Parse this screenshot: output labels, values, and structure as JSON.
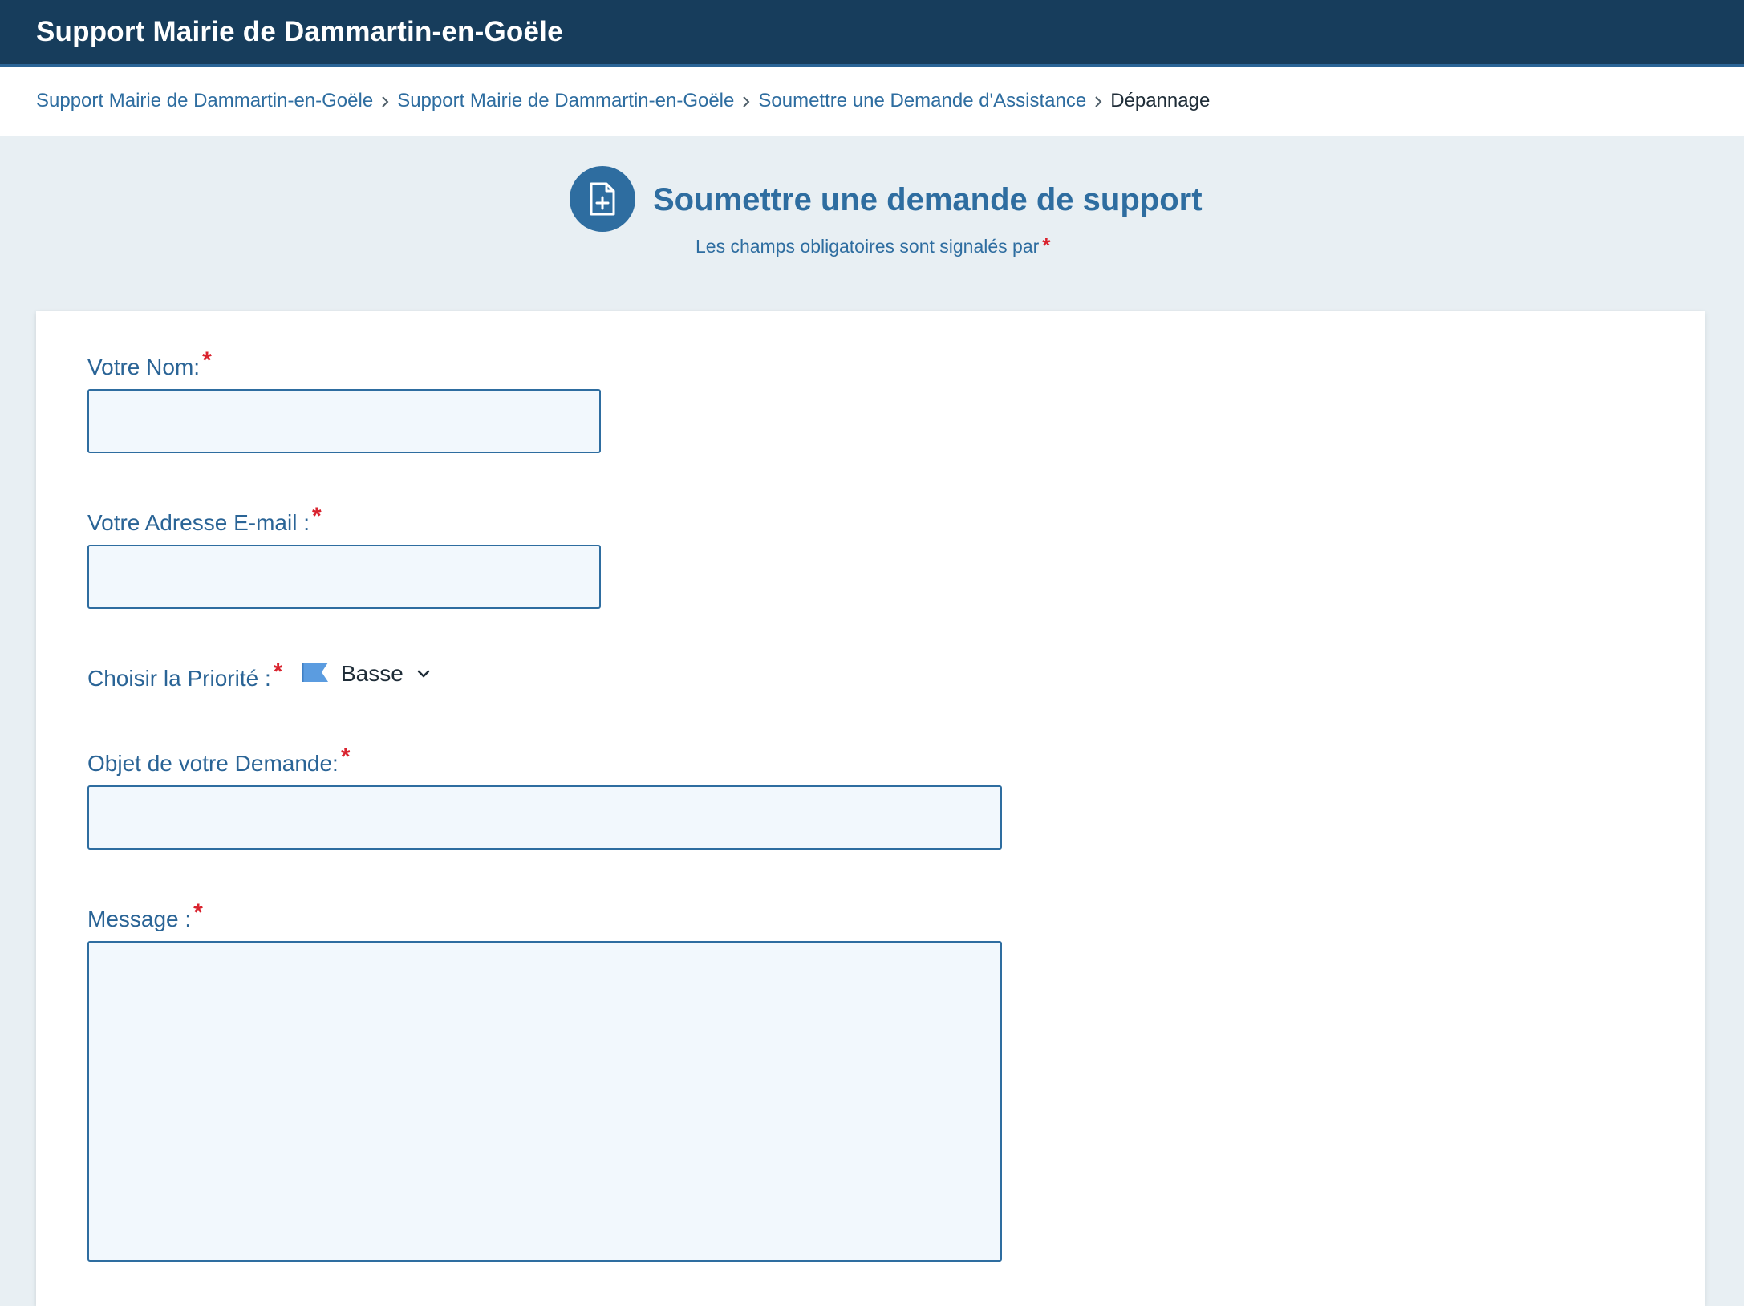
{
  "app": {
    "title": "Support Mairie de Dammartin-en-Goële"
  },
  "breadcrumb": [
    {
      "label": "Support Mairie de Dammartin-en-Goële"
    },
    {
      "label": "Support Mairie de Dammartin-en-Goële"
    },
    {
      "label": "Soumettre une Demande d'Assistance"
    },
    {
      "label": "Dépannage"
    }
  ],
  "header": {
    "icon": "file-plus-icon",
    "title": "Soumettre une demande de support",
    "subtitle": "Les champs obligatoires sont signalés par",
    "required_marker": "*"
  },
  "form": {
    "name": {
      "label": "Votre Nom:",
      "required": "*",
      "value": "",
      "placeholder": ""
    },
    "email": {
      "label": "Votre Adresse E-mail :",
      "required": "*",
      "value": "",
      "placeholder": ""
    },
    "priority": {
      "label": "Choisir la Priorité :",
      "required": "*",
      "selected": "Basse",
      "flag_icon": "flag-icon",
      "flag_color": "#5b9ce0"
    },
    "subject": {
      "label": "Objet de votre Demande:",
      "required": "*",
      "value": "",
      "placeholder": ""
    },
    "message": {
      "label": "Message :",
      "required": "*",
      "value": "",
      "placeholder": ""
    }
  },
  "colors": {
    "topbar": "#173d5c",
    "accent": "#2e6da0",
    "required": "#d9232e",
    "input_bg": "#f2f8fd",
    "page_bg": "#e8eff3"
  }
}
